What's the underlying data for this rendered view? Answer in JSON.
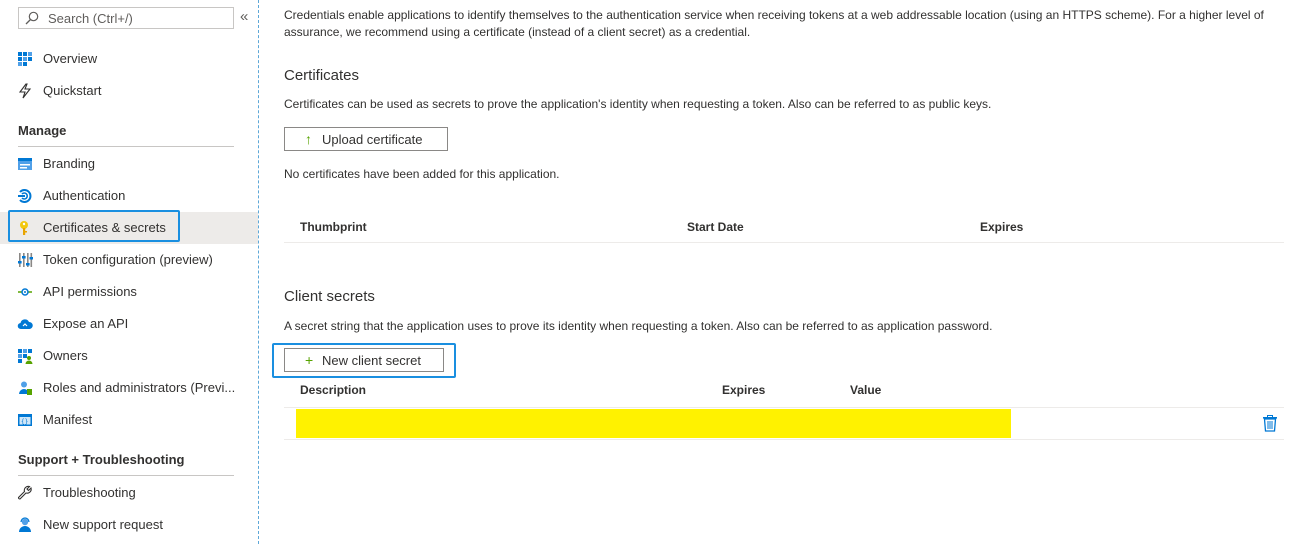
{
  "sidebar": {
    "search_placeholder": "Search (Ctrl+/)",
    "collapse_glyph": "«",
    "items_top": [
      {
        "label": "Overview",
        "icon": "overview-grid-icon"
      },
      {
        "label": "Quickstart",
        "icon": "lightning-icon"
      }
    ],
    "manage_header": "Manage",
    "manage_items": [
      {
        "label": "Branding",
        "icon": "branding-icon"
      },
      {
        "label": "Authentication",
        "icon": "authentication-icon"
      },
      {
        "label": "Certificates & secrets",
        "icon": "key-icon",
        "active": true
      },
      {
        "label": "Token configuration (preview)",
        "icon": "token-config-icon"
      },
      {
        "label": "API permissions",
        "icon": "api-permissions-icon"
      },
      {
        "label": "Expose an API",
        "icon": "cloud-icon"
      },
      {
        "label": "Owners",
        "icon": "owners-icon"
      },
      {
        "label": "Roles and administrators (Previ...",
        "icon": "roles-icon"
      },
      {
        "label": "Manifest",
        "icon": "manifest-icon"
      }
    ],
    "support_header": "Support + Troubleshooting",
    "support_items": [
      {
        "label": "Troubleshooting",
        "icon": "wrench-icon"
      },
      {
        "label": "New support request",
        "icon": "support-person-icon"
      }
    ]
  },
  "main": {
    "intro": "Credentials enable applications to identify themselves to the authentication service when receiving tokens at a web addressable location (using an HTTPS scheme). For a higher level of assurance, we recommend using a certificate (instead of a client secret) as a credential.",
    "certificates": {
      "title": "Certificates",
      "description": "Certificates can be used as secrets to prove the application's identity when requesting a token. Also can be referred to as public keys.",
      "upload_label": "Upload certificate",
      "empty_message": "No certificates have been added for this application.",
      "columns": [
        "Thumbprint",
        "Start Date",
        "Expires"
      ]
    },
    "secrets": {
      "title": "Client secrets",
      "description": "A secret string that the application uses to prove its identity when requesting a token. Also can be referred to as application password.",
      "new_label": "New client secret",
      "columns": [
        "Description",
        "Expires",
        "Value"
      ]
    }
  },
  "colors": {
    "accent": "#1a8fe0",
    "highlight": "#fff200",
    "green_icon": "#57a300"
  }
}
